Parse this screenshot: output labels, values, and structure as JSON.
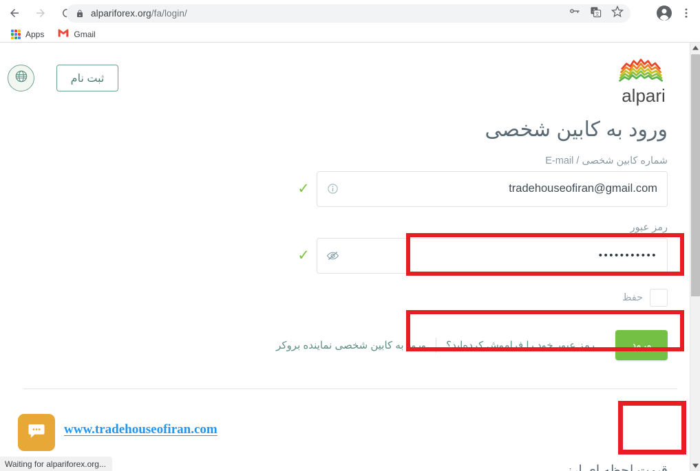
{
  "browser": {
    "url_host": "alpariforex.org",
    "url_path": "/fa/login/",
    "nav": {
      "back": "back-arrow",
      "forward": "forward-arrow",
      "reload": "reload-icon"
    },
    "omnibox_icons": [
      "key-icon",
      "translate-icon",
      "bookmark-star-icon"
    ],
    "right_icons": [
      "profile-avatar",
      "three-dot-menu"
    ],
    "bookmarks": [
      {
        "label": "Apps",
        "icon": "apps-grid-icon"
      },
      {
        "label": "Gmail",
        "icon": "gmail-icon"
      }
    ],
    "status_text": "Waiting for alpariforex.org..."
  },
  "page": {
    "register_button": "ثبت نام",
    "globe_icon": "globe-icon",
    "logo_word": "alpari",
    "title": "ورود به کابین شخصی",
    "email": {
      "label": "شماره کابین شخصی / E-mail",
      "value": "tradehouseofiran@gmail.com",
      "icon": "info-icon",
      "valid_mark": "✓"
    },
    "password": {
      "label": "رمز عبور",
      "value": "•••••••••••",
      "icon": "eye-slash-icon",
      "valid_mark": "✓"
    },
    "remember": {
      "label": "حفظ",
      "checked": false
    },
    "login_button": "ورود",
    "links": [
      "رمز عبور خود را فراموش کرده‌اید؟",
      "ورود به کابین شخصی نماینده بروکر"
    ],
    "watermark": "www.tradehouseofiran.com",
    "chat_icon": "chat-bubble-icon",
    "cut_text": "قیمت لحظه ای ارز"
  },
  "colors": {
    "brand_green": "#74c044",
    "teal": "#6f9e93",
    "annotation_red": "#e81d24",
    "watermark_blue": "#2196f3",
    "chat_orange": "#e8a838"
  }
}
